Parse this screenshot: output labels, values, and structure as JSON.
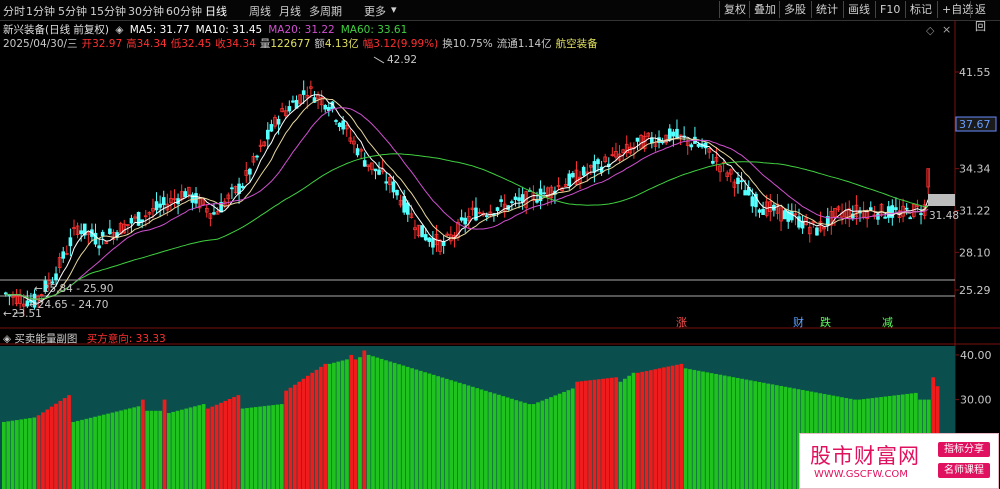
{
  "toolbar": {
    "periods": [
      "分时",
      "1分钟",
      "5分钟",
      "15分钟",
      "30分钟",
      "60分钟",
      "日线",
      "周线",
      "月线",
      "多周期",
      "更多"
    ],
    "active_period": "日线",
    "more_arrow": "▾",
    "right_buttons": [
      "复权",
      "叠加",
      "多股",
      "统计",
      "画线",
      "F10",
      "标记",
      "+自选",
      "返回"
    ]
  },
  "header": {
    "stock_title": "新兴装备(日线 前复权)",
    "ma": [
      {
        "label": "MA5: 31.77",
        "color": "#ffffff"
      },
      {
        "label": "MA10: 31.45",
        "color": "#ffffff"
      },
      {
        "label": "MA20: 31.22",
        "color": "#d050d0"
      },
      {
        "label": "MA60: 33.61",
        "color": "#40d040"
      }
    ],
    "quote": [
      {
        "text": "2025/04/30/三",
        "color": "#c8c8c8"
      },
      {
        "text": "开",
        "color": "#ff3030"
      },
      {
        "text": "32.97",
        "color": "#ff3030"
      },
      {
        "text": "高",
        "color": "#ff3030"
      },
      {
        "text": "34.34",
        "color": "#ff3030"
      },
      {
        "text": "低",
        "color": "#ff3030"
      },
      {
        "text": "32.45",
        "color": "#ff3030"
      },
      {
        "text": "收",
        "color": "#ff3030"
      },
      {
        "text": "34.34",
        "color": "#ff3030"
      },
      {
        "text": "量",
        "color": "#c8c8c8"
      },
      {
        "text": "122677",
        "color": "#e0e060"
      },
      {
        "text": "额",
        "color": "#c8c8c8"
      },
      {
        "text": "4.13亿",
        "color": "#e0e060"
      },
      {
        "text": "幅",
        "color": "#ff3030"
      },
      {
        "text": "3.12(9.99%)",
        "color": "#ff3030"
      },
      {
        "text": "换",
        "color": "#c8c8c8"
      },
      {
        "text": "10.75%",
        "color": "#c8c8c8"
      },
      {
        "text": "流通",
        "color": "#c8c8c8"
      },
      {
        "text": "1.14亿",
        "color": "#c8c8c8"
      },
      {
        "text": "航空装备",
        "color": "#e0e060"
      }
    ]
  },
  "price_axis": {
    "ticks": [
      "41.55",
      "37.67",
      "34.34",
      "31.22",
      "28.10",
      "25.29"
    ],
    "current_price": "37.67",
    "mark_price": "31.48"
  },
  "annotations": {
    "high": "42.92",
    "low": "23.51",
    "range1": "25.84 - 25.90",
    "range2": "24.65 - 24.70"
  },
  "event_markers": [
    {
      "text": "涨",
      "color": "#ff5050"
    },
    {
      "text": "财",
      "color": "#60a0ff"
    },
    {
      "text": "跌",
      "color": "#60ff60"
    },
    {
      "text": "减",
      "color": "#60ff60"
    }
  ],
  "sub_indicator": {
    "name": "买卖能量副图",
    "label": "买方意向:",
    "value": "33.33",
    "ticks": [
      "40.00",
      "30.00",
      "20.00"
    ]
  },
  "watermark": {
    "main": "股市财富网",
    "url": "WWW.GSCFW.COM",
    "tag1": "指标分享",
    "tag2": "名师课程"
  },
  "chart_data": {
    "type": "bar",
    "title": "",
    "xlabel": "",
    "ylabel": "",
    "ylim": [
      10,
      42
    ],
    "series": [
      {
        "name": "买方意向",
        "last_value": 33.33
      }
    ],
    "segments": [
      {
        "count": 8,
        "color": "green",
        "start": 25.0,
        "end": 26.0
      },
      {
        "count": 8,
        "color": "red",
        "start": 26.5,
        "end": 31.0
      },
      {
        "count": 16,
        "color": "green",
        "start": 25.0,
        "end": 28.5
      },
      {
        "count": 1,
        "color": "red",
        "start": 30.0,
        "end": 30.0
      },
      {
        "count": 4,
        "color": "green",
        "start": 27.5,
        "end": 27.5
      },
      {
        "count": 1,
        "color": "red",
        "start": 30.0,
        "end": 30.0
      },
      {
        "count": 9,
        "color": "green",
        "start": 27.0,
        "end": 29.0
      },
      {
        "count": 8,
        "color": "red",
        "start": 28.0,
        "end": 31.0
      },
      {
        "count": 10,
        "color": "green",
        "start": 28.0,
        "end": 29.0
      },
      {
        "count": 10,
        "color": "red",
        "start": 32.0,
        "end": 38.0
      },
      {
        "count": 5,
        "color": "green",
        "start": 38.0,
        "end": 39.0
      },
      {
        "count": 2,
        "color": "red",
        "start": 40.0,
        "end": 39.0
      },
      {
        "count": 1,
        "color": "green",
        "start": 39.5,
        "end": 39.5
      },
      {
        "count": 1,
        "color": "red",
        "start": 41.0,
        "end": 41.0
      },
      {
        "count": 38,
        "color": "green",
        "start": 40.0,
        "end": 29.0
      },
      {
        "count": 10,
        "color": "green",
        "start": 29.0,
        "end": 32.5
      },
      {
        "count": 10,
        "color": "red",
        "start": 34.0,
        "end": 35.0
      },
      {
        "count": 4,
        "color": "green",
        "start": 34.0,
        "end": 36.0
      },
      {
        "count": 11,
        "color": "red",
        "start": 36.0,
        "end": 38.0
      },
      {
        "count": 40,
        "color": "green",
        "start": 37.0,
        "end": 30.0
      },
      {
        "count": 14,
        "color": "green",
        "start": 30.0,
        "end": 31.5
      },
      {
        "count": 3,
        "color": "green",
        "start": 30.0,
        "end": 30.0
      },
      {
        "count": 1,
        "color": "red",
        "start": 35.0,
        "end": 35.0
      },
      {
        "count": 1,
        "color": "red",
        "start": 33.0,
        "end": 33.0
      }
    ]
  }
}
